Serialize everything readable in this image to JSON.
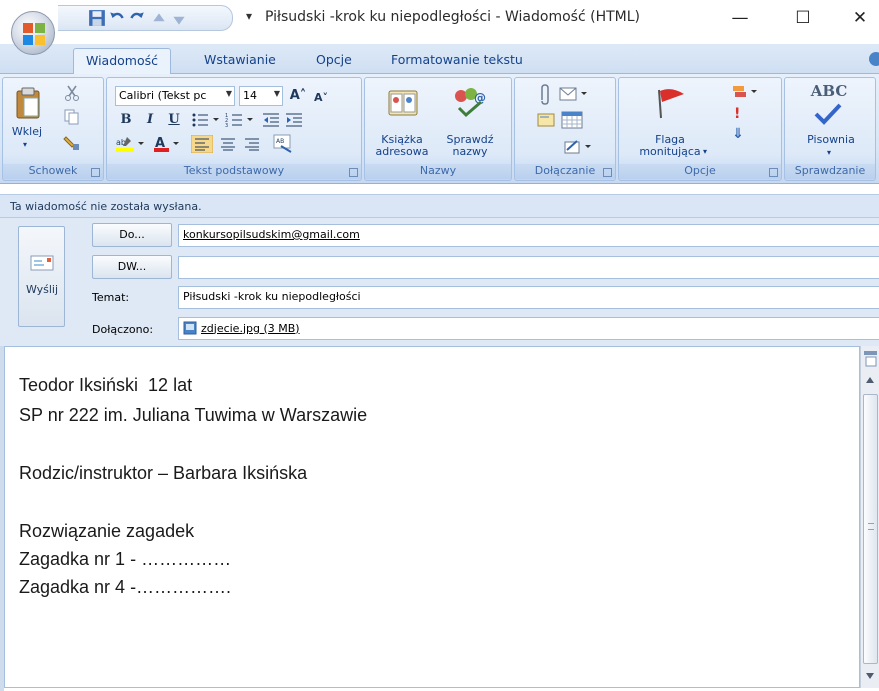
{
  "window": {
    "title": "Piłsudski -krok ku niepodległości - Wiadomość (HTML)",
    "minimize": "—",
    "maximize": "☐",
    "close": "✕"
  },
  "ribbon_tabs": [
    "Wiadomość",
    "Wstawianie",
    "Opcje",
    "Formatowanie tekstu"
  ],
  "ribbon": {
    "clipboard": {
      "paste_label": "Wklej",
      "group_label": "Schowek"
    },
    "basic_text": {
      "font_name": "Calibri (Tekst pᴄ",
      "font_size": "14",
      "group_label": "Tekst podstawowy",
      "bold": "B",
      "italic": "I",
      "underline": "U",
      "grow": "A˄",
      "shrink": "A˅"
    },
    "names": {
      "address_book": "Książka\nadresowa",
      "check_names": "Sprawdź\nnazwy",
      "group_label": "Nazwy"
    },
    "attach": {
      "group_label": "Dołączanie"
    },
    "options": {
      "follow_up": "Flaga\nmonitująca",
      "group_label": "Opcje"
    },
    "proofing": {
      "spelling": "Pisownia",
      "abc": "ABC",
      "group_label": "Sprawdzanie"
    }
  },
  "infobar": "Ta wiadomość nie została wysłana.",
  "header": {
    "send_label": "Wyślij",
    "to_button": "Do...",
    "to_value": "konkursopilsudskim@gmail.com",
    "cc_button": "DW...",
    "cc_value": "",
    "subject_label": "Temat:",
    "subject_value": "Piłsudski -krok ku niepodległości",
    "attached_label": "Dołączono:",
    "attachment": "zdjecie.jpg (3 MB)"
  },
  "body_lines": [
    "Teodor Iksiński  12 lat",
    "SP nr 222 im. Juliana Tuwima w Warszawie",
    "",
    "Rodzic/instruktor – Barbara Iksińska",
    "",
    "Rozwiązanie zagadek",
    "Zagadka nr 1 - ……………",
    "Zagadka nr 4 -……………."
  ],
  "colors": {
    "ribbon_text": "#15428b",
    "ribbon_bg": "#d7e5f6",
    "infobar_bg": "#dae6f6",
    "header_bg": "#dfe9f5"
  }
}
